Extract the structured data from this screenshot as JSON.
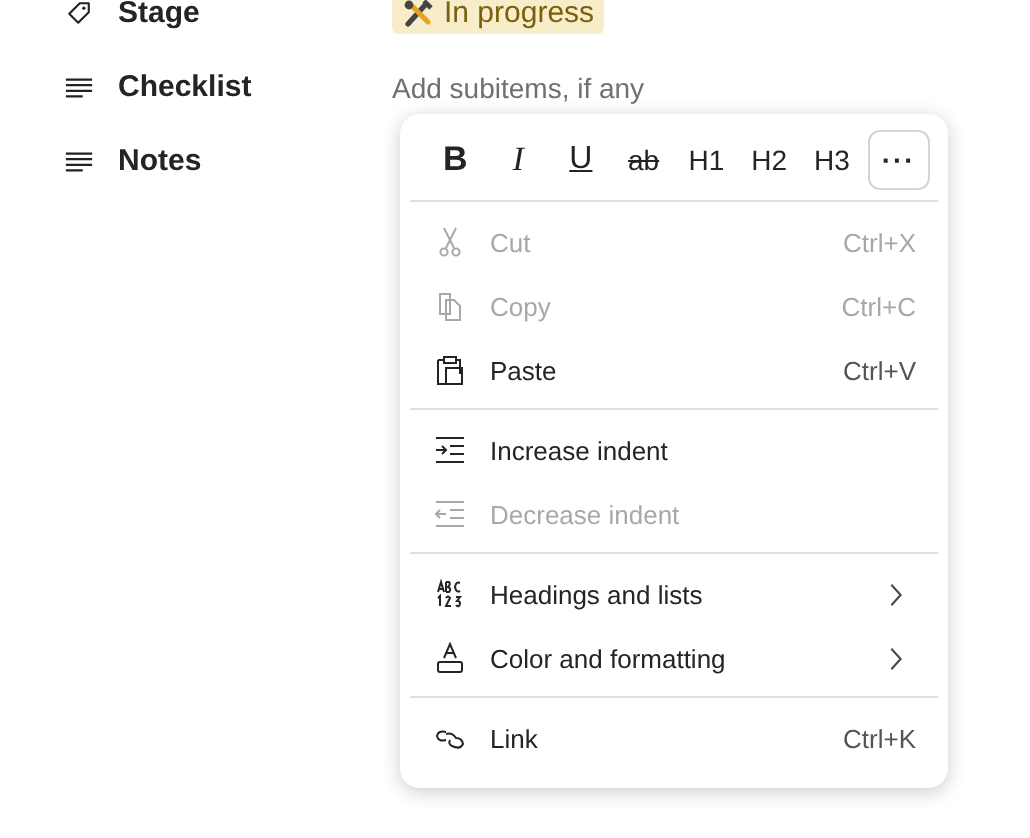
{
  "fields": [
    {
      "kind": "stage",
      "label": "Stage",
      "value": "In progress"
    },
    {
      "kind": "checklist",
      "label": "Checklist",
      "placeholder": "Add subitems, if any"
    },
    {
      "kind": "notes",
      "label": "Notes"
    }
  ],
  "menu": {
    "format_buttons": [
      {
        "kind": "bold",
        "label": "B"
      },
      {
        "kind": "italic",
        "label": "I"
      },
      {
        "kind": "underline",
        "label": "U"
      },
      {
        "kind": "strike",
        "label": "ab"
      },
      {
        "kind": "heading",
        "label": "H1"
      },
      {
        "kind": "heading",
        "label": "H2"
      },
      {
        "kind": "heading",
        "label": "H3"
      },
      {
        "kind": "more",
        "label": "···"
      }
    ],
    "sections": [
      [
        {
          "kind": "cut",
          "label": "Cut",
          "shortcut": "Ctrl+X",
          "disabled": true
        },
        {
          "kind": "copy",
          "label": "Copy",
          "shortcut": "Ctrl+C",
          "disabled": true
        },
        {
          "kind": "paste",
          "label": "Paste",
          "shortcut": "Ctrl+V",
          "disabled": false
        }
      ],
      [
        {
          "kind": "indent",
          "label": "Increase indent",
          "disabled": false
        },
        {
          "kind": "outdent",
          "label": "Decrease indent",
          "disabled": true
        }
      ],
      [
        {
          "kind": "lists",
          "label": "Headings and lists",
          "submenu": true,
          "disabled": false
        },
        {
          "kind": "format",
          "label": "Color and formatting",
          "submenu": true,
          "disabled": false
        }
      ],
      [
        {
          "kind": "link",
          "label": "Link",
          "shortcut": "Ctrl+K",
          "disabled": false
        }
      ]
    ]
  }
}
